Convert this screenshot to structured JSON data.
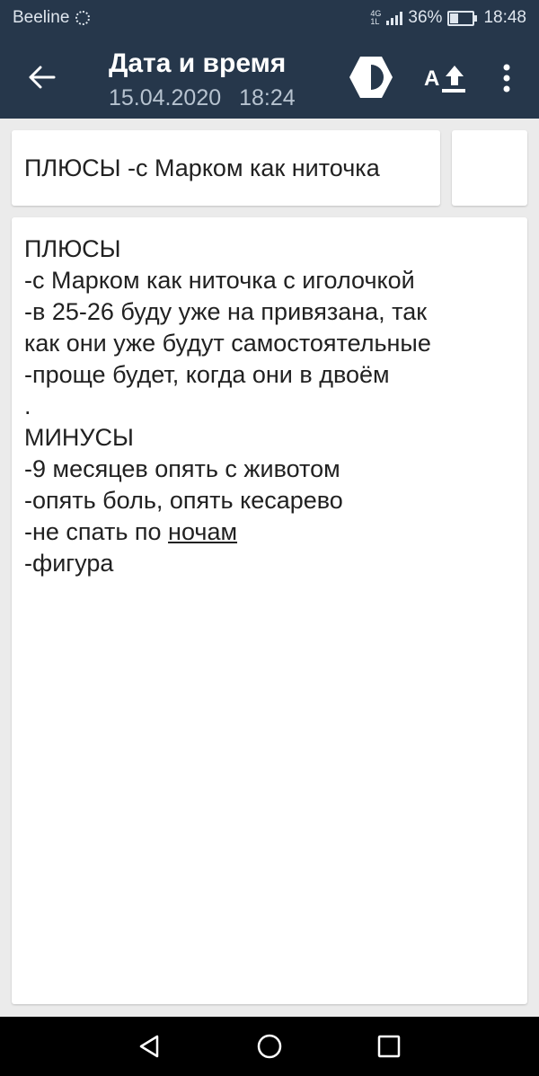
{
  "status_bar": {
    "carrier": "Beeline",
    "network": [
      "4G",
      "1L"
    ],
    "battery": "36%",
    "battery_level": 0.36,
    "time": "18:48"
  },
  "app_bar": {
    "title": "Дата и время",
    "date": "15.04.2020",
    "time": "18:24",
    "icons": [
      "back-arrow-icon",
      "theme-contrast-icon",
      "font-size-up-icon",
      "more-vert-icon"
    ]
  },
  "note": {
    "title": "ПЛЮСЫ -с Марком как ниточка",
    "lines": [
      "ПЛЮСЫ",
      "-с Марком как ниточка с иголочкой",
      "-в 25-26 буду уже на привязана, так",
      "как они уже будут самостоятельные",
      "-проще будет, когда они в двоём",
      ".",
      "МИНУСЫ",
      "-9 месяцев опять с животом",
      "-опять боль, опять кесарево",
      "-фигура"
    ],
    "line_underline_prefix": "-не спать по ",
    "line_underline_word": "ночам"
  },
  "nav_bar": {
    "icons": [
      "back-triangle-icon",
      "home-circle-icon",
      "recents-square-icon"
    ]
  },
  "colors": {
    "bar_background": "#26374b",
    "page_background": "#ebebeb",
    "card_background": "#ffffff",
    "subtitle_text": "#b7c3d0"
  }
}
